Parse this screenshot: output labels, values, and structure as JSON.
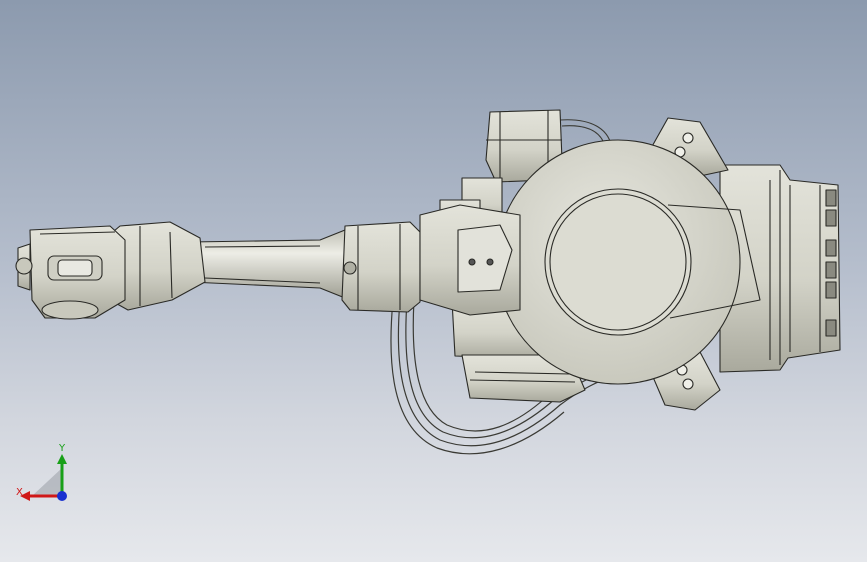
{
  "viewport": {
    "background_top": "#8c9aae",
    "background_bottom": "#e6e8ec",
    "model_fill": "#d6d6cb",
    "model_shade": "#b8b8ac",
    "edge_color": "#2a2a26"
  },
  "triad": {
    "x_label": "X",
    "y_label": "Y",
    "x_color": "#d01818",
    "y_color": "#18a018",
    "z_color": "#1830d0"
  }
}
